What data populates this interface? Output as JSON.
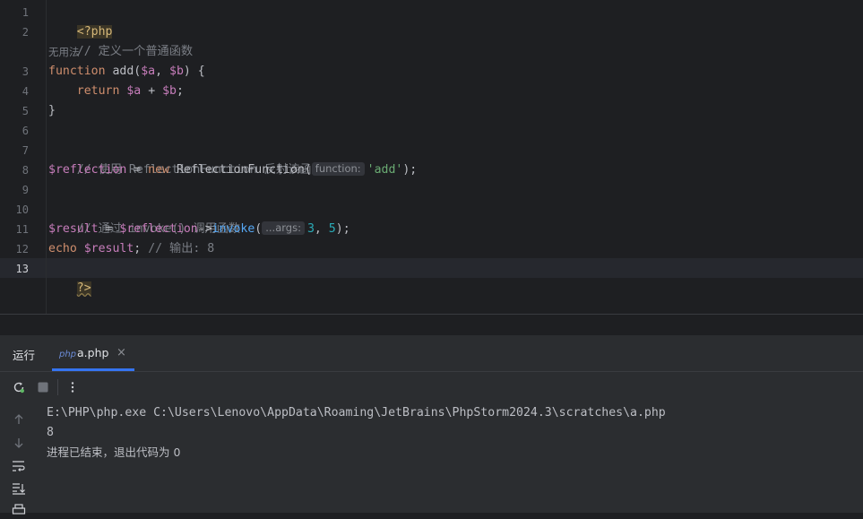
{
  "editor": {
    "line_numbers": [
      "1",
      "2",
      "3",
      "4",
      "5",
      "6",
      "7",
      "8",
      "9",
      "10",
      "11",
      "12",
      "13"
    ],
    "inlay_usage_text": "无用法",
    "lines": {
      "l1_open": "<?php",
      "l2_comment": "// 定义一个普通函数",
      "l3_kw": "function",
      "l3_fn": " add(",
      "l3_a": "$a",
      "l3_sep": ", ",
      "l3_b": "$b",
      "l3_end": ") {",
      "l4_indent": "    ",
      "l4_kw": "return",
      "l4_sp": " ",
      "l4_a": "$a",
      "l4_plus": " + ",
      "l4_b": "$b",
      "l4_end": ";",
      "l5": "}",
      "l7_comment": "// 使用 ReflectionFunction 反射该函数",
      "l8_var": "$reflection",
      "l8_eq": " = ",
      "l8_new": "new",
      "l8_cls": " ReflectionFunction(",
      "l8_hint": "function:",
      "l8_str": "'add'",
      "l8_end": ");",
      "l10_comment": "// 通过 invoke() 调用函数",
      "l11_var": "$result",
      "l11_eq": " = ",
      "l11_refl": "$reflection",
      "l11_arrow": "->",
      "l11_method": "invoke",
      "l11_paren": "(",
      "l11_hint": "...args:",
      "l11_n1": "3",
      "l11_sep": ", ",
      "l11_n2": "5",
      "l11_end": ");",
      "l12_kw": "echo",
      "l12_sp": " ",
      "l12_var": "$result",
      "l12_semi": ";",
      "l12_comment": " // 输出: 8",
      "l13_close": "?>"
    }
  },
  "run_panel": {
    "title": "运行",
    "tab_icon": "php",
    "tab_label": "a.php",
    "tab_close": "×",
    "toolbar_icons": [
      "rerun-icon",
      "stop-icon",
      "more-vertical-icon"
    ],
    "side_icons": [
      "scroll-up-icon",
      "scroll-down-icon",
      "soft-wrap-icon",
      "scroll-to-end-icon",
      "print-icon"
    ]
  },
  "console": {
    "lines": [
      "E:\\PHP\\php.exe C:\\Users\\Lenovo\\AppData\\Roaming\\JetBrains\\PhpStorm2024.3\\scratches\\a.php",
      "8",
      "进程已结束，退出代码为 0"
    ]
  },
  "colors": {
    "background": "#1e1f22",
    "keyword": "#cf8e6d",
    "variable": "#c77dbb",
    "method": "#56a8f5",
    "comment": "#7a7e85",
    "string": "#6aab73",
    "number": "#2aacb8",
    "accent": "#3574f0"
  }
}
